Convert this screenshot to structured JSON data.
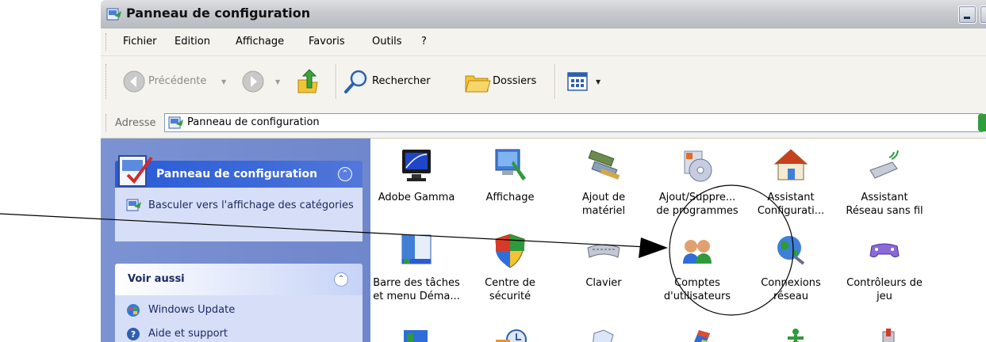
{
  "window": {
    "title": "Panneau de configuration"
  },
  "menu": [
    "Fichier",
    "Edition",
    "Affichage",
    "Favoris",
    "Outils",
    "?"
  ],
  "toolbar": {
    "back": "Précédente",
    "search": "Rechercher",
    "folders": "Dossiers"
  },
  "address": {
    "label": "Adresse",
    "value": "Panneau de configuration"
  },
  "sidebar": {
    "panel1": {
      "title": "Panneau de configuration",
      "link": "Basculer vers l'affichage des catégories"
    },
    "panel2": {
      "title": "Voir aussi",
      "links": [
        "Windows Update",
        "Aide et support"
      ]
    }
  },
  "items": [
    {
      "label": "Adobe Gamma",
      "icon": "monitor-icon"
    },
    {
      "label": "Affichage",
      "icon": "display-icon"
    },
    {
      "label": "Ajout de\nmatériel",
      "icon": "hardware-icon"
    },
    {
      "label": "Ajout/Suppre...\nde programmes",
      "icon": "programs-icon"
    },
    {
      "label": "Assistant\nConfigurati...",
      "icon": "home-network-icon"
    },
    {
      "label": "Assistant\nRéseau sans fil",
      "icon": "wireless-icon"
    },
    {
      "label": "Barre des tâches\net menu Déma...",
      "icon": "taskbar-icon"
    },
    {
      "label": "Centre de\nsécurité",
      "icon": "shield-icon"
    },
    {
      "label": "Clavier",
      "icon": "keyboard-icon"
    },
    {
      "label": "Comptes\nd'utilisateurs",
      "icon": "users-icon"
    },
    {
      "label": "Connexions\nréseau",
      "icon": "network-icon"
    },
    {
      "label": "Contrôleurs de\njeu",
      "icon": "gamepad-icon"
    }
  ]
}
